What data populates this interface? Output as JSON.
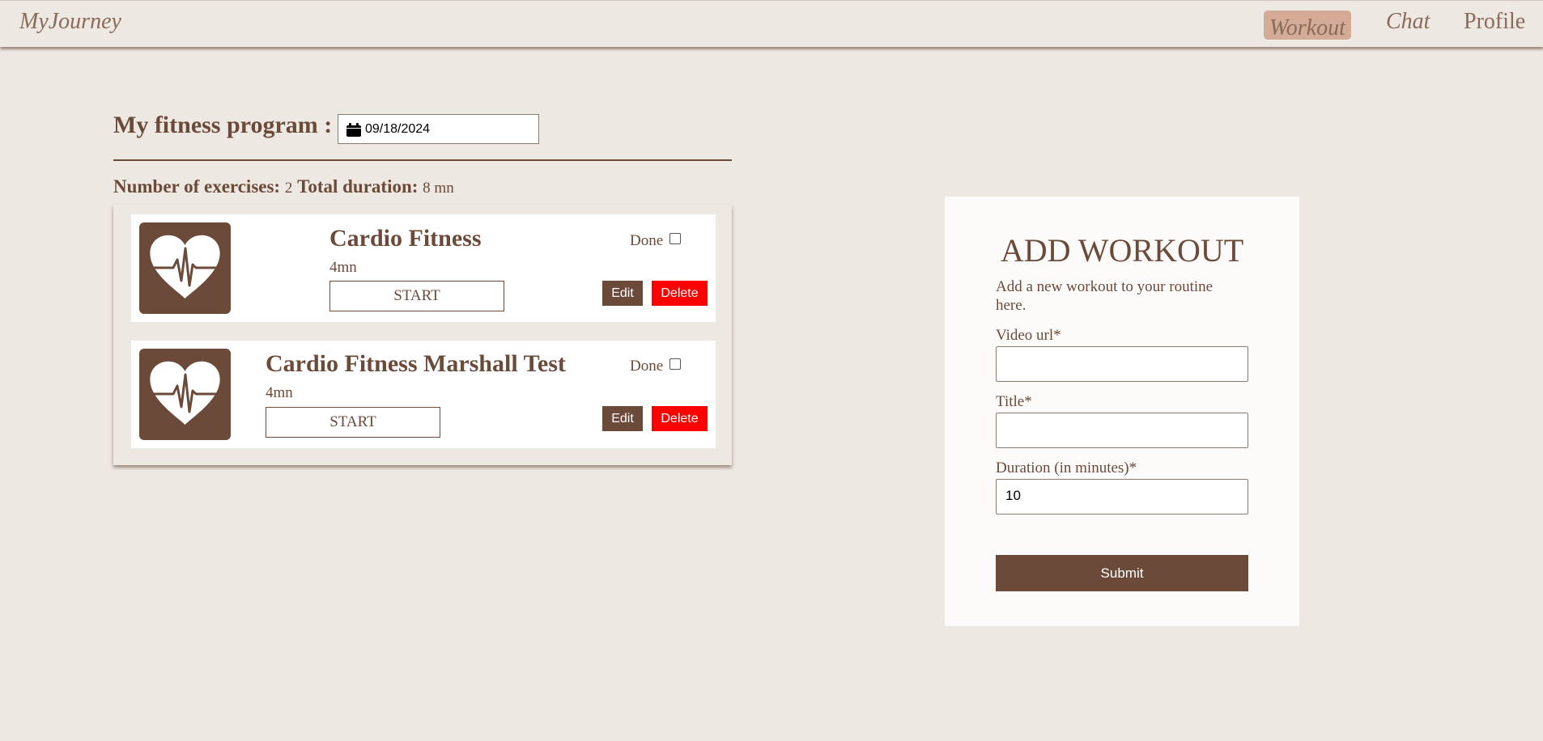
{
  "nav": {
    "brand": "MyJourney",
    "items": [
      {
        "label": "Workout",
        "active": true
      },
      {
        "label": "Chat"
      },
      {
        "label": "Profile"
      }
    ]
  },
  "program": {
    "title": "My fitness program :",
    "date": "09/18/2024",
    "exercises_label": "Number of exercises:",
    "exercises_count": "2",
    "duration_label": "Total duration:",
    "duration_value": "8 mn"
  },
  "workouts": [
    {
      "title": "Cardio Fitness",
      "duration": "4mn",
      "start_label": "START",
      "done_label": "Done",
      "done": false,
      "edit_label": "Edit",
      "delete_label": "Delete",
      "icon": "heart-pulse-icon"
    },
    {
      "title": "Cardio Fitness Marshall Test",
      "duration": "4mn",
      "start_label": "START",
      "done_label": "Done",
      "done": false,
      "edit_label": "Edit",
      "delete_label": "Delete",
      "icon": "heart-pulse-icon"
    }
  ],
  "add_workout": {
    "title": "ADD WORKOUT",
    "description": "Add a new workout to your routine here.",
    "video_url_label": "Video url*",
    "video_url_value": "",
    "title_label": "Title*",
    "title_value": "",
    "duration_label": "Duration (in minutes)*",
    "duration_value": "10",
    "submit_label": "Submit"
  },
  "colors": {
    "background": "#ede8e2",
    "primary": "#6b4a3a",
    "active_nav": "#d3ab97",
    "delete": "#ff0000"
  }
}
